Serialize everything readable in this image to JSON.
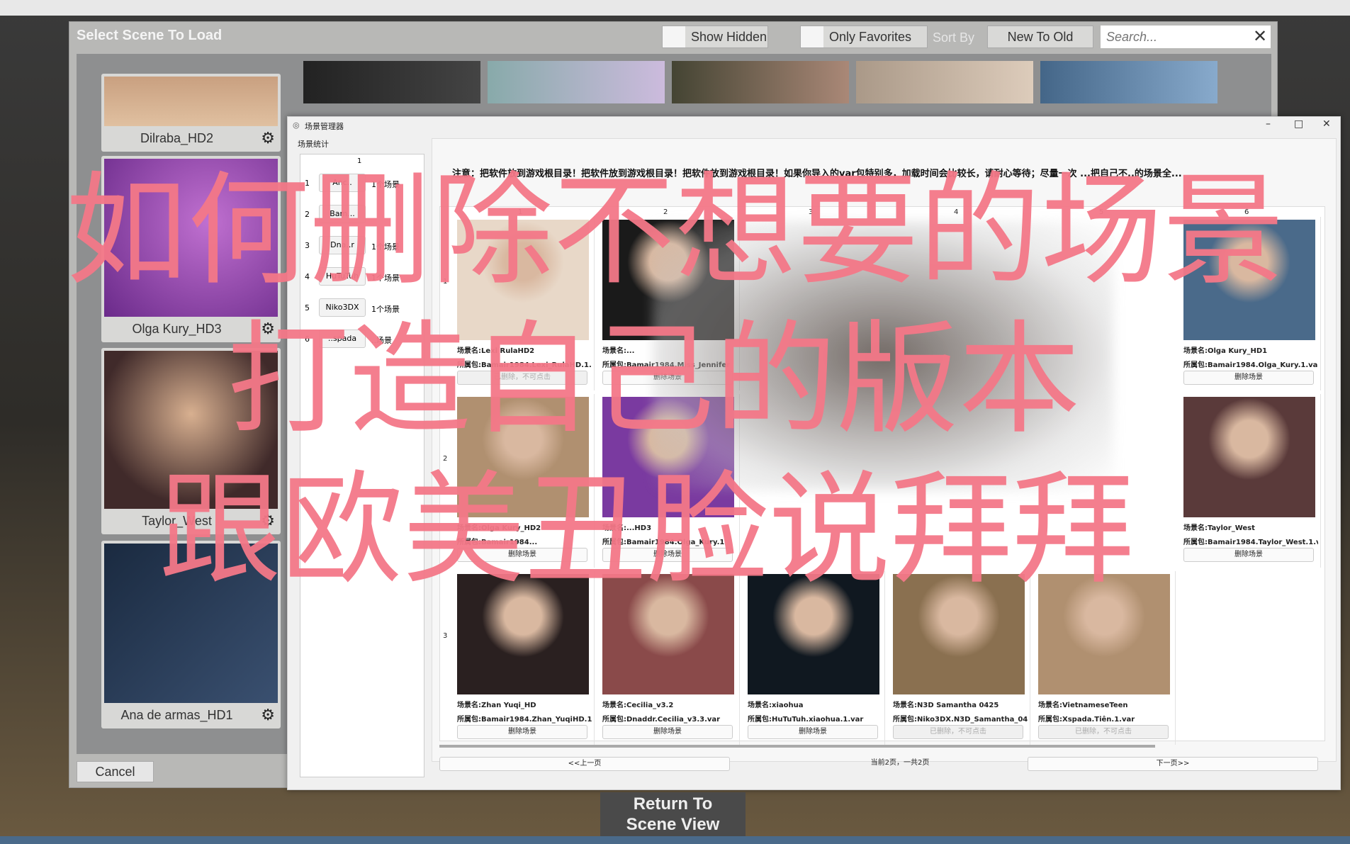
{
  "vam_dialog": {
    "title": "Select Scene To Load",
    "show_hidden": "Show Hidden",
    "only_favorites": "Only Favorites",
    "sort_by_label": "Sort By",
    "sort_value": "New To Old",
    "search_placeholder": "Search...",
    "cancel": "Cancel",
    "cards": [
      {
        "name": "Dilraba_HD2"
      },
      {
        "name": "Olga Kury_HD3"
      },
      {
        "name": "Taylor_West"
      },
      {
        "name": "Ana de armas_HD1"
      }
    ]
  },
  "return_button": {
    "line1": "Return To",
    "line2": "Scene View"
  },
  "manager": {
    "title": "场景管理器",
    "stats_label": "场景统计",
    "stats_col": "1",
    "stats_rows": [
      {
        "n": "1",
        "creator": "Anc..",
        "count": "1个场景"
      },
      {
        "n": "2",
        "creator": "Bam...",
        "count": ""
      },
      {
        "n": "3",
        "creator": "Dna..r",
        "count": "1个场景"
      },
      {
        "n": "4",
        "creator": "HuTuTuh",
        "count": "1个场景"
      },
      {
        "n": "5",
        "creator": "Niko3DX",
        "count": "1个场景"
      },
      {
        "n": "6",
        "creator": "..spada",
        "count": "..场景"
      }
    ],
    "notice": "注意：把软件放到游戏根目录！把软件放到游戏根目录！把软件放到游戏根目录！如果你导入的var包特别多，加载时间会比较长，请耐心等待；尽量一次 ...把自己不..的场景全...",
    "col_headers": [
      "1",
      "2",
      "3",
      "4",
      "5",
      "6"
    ],
    "row_headers": [
      "1",
      "2",
      "3"
    ],
    "scenes": [
      {
        "row": 0,
        "col": 0,
        "name": "场景名:Lexi RulaHD2",
        "pkg": "所属包:Bamair1984.Lexi_RulaHD.1.va",
        "action": "已删除，不可点击",
        "deleted": true
      },
      {
        "row": 0,
        "col": 1,
        "name": "场景名:...",
        "pkg": "所属包:Bamair1984.Miss_Jennifer",
        "action": "删除场景",
        "deleted": false
      },
      {
        "row": 0,
        "col": 5,
        "name": "场景名:Olga Kury_HD1",
        "pkg": "所属包:Bamair1984.Olga_Kury.1.var",
        "action": "删除场景",
        "deleted": false
      },
      {
        "row": 1,
        "col": 0,
        "name": "场景名:Olga Kury_HD2",
        "pkg": "所属包:Bamair1984...",
        "action": "删除场景",
        "deleted": false
      },
      {
        "row": 1,
        "col": 1,
        "name": "场景名:...HD3",
        "pkg": "所属包:Bamair1984.Olga_Kury.1",
        "action": "删除场景",
        "deleted": false
      },
      {
        "row": 1,
        "col": 5,
        "name": "场景名:Taylor_West",
        "pkg": "所属包:Bamair1984.Taylor_West.1.va",
        "action": "删除场景",
        "deleted": false
      },
      {
        "row": 2,
        "col": 0,
        "name": "场景名:Zhan Yuqi_HD",
        "pkg": "所属包:Bamair1984.Zhan_YuqiHD.1.v",
        "action": "删除场景",
        "deleted": false
      },
      {
        "row": 2,
        "col": 1,
        "name": "场景名:Cecilia_v3.2",
        "pkg": "所属包:Dnaddr.Cecilia_v3.3.var",
        "action": "删除场景",
        "deleted": false
      },
      {
        "row": 2,
        "col": 2,
        "name": "场景名:xiaohua",
        "pkg": "所属包:HuTuTuh.xiaohua.1.var",
        "action": "删除场景",
        "deleted": false
      },
      {
        "row": 2,
        "col": 3,
        "name": "场景名:N3D Samantha 0425",
        "pkg": "所属包:Niko3DX.N3D_Samantha_042",
        "action": "已删除，不可点击",
        "deleted": true
      },
      {
        "row": 2,
        "col": 4,
        "name": "场景名:VietnameseTeen",
        "pkg": "所属包:Xspada.Tiên.1.var",
        "action": "已删除，不可点击",
        "deleted": true
      }
    ],
    "prev_page": "<<上一页",
    "page_info": "当前2页，一共2页",
    "next_page": "下一页>>"
  },
  "overlay_title": [
    "如何删除不想要的场景",
    "打造自己的版本",
    "跟欧美丑脸说拜拜"
  ],
  "colors": {
    "overlay": "#f47888",
    "vam_panel": "#b8b8b6"
  }
}
